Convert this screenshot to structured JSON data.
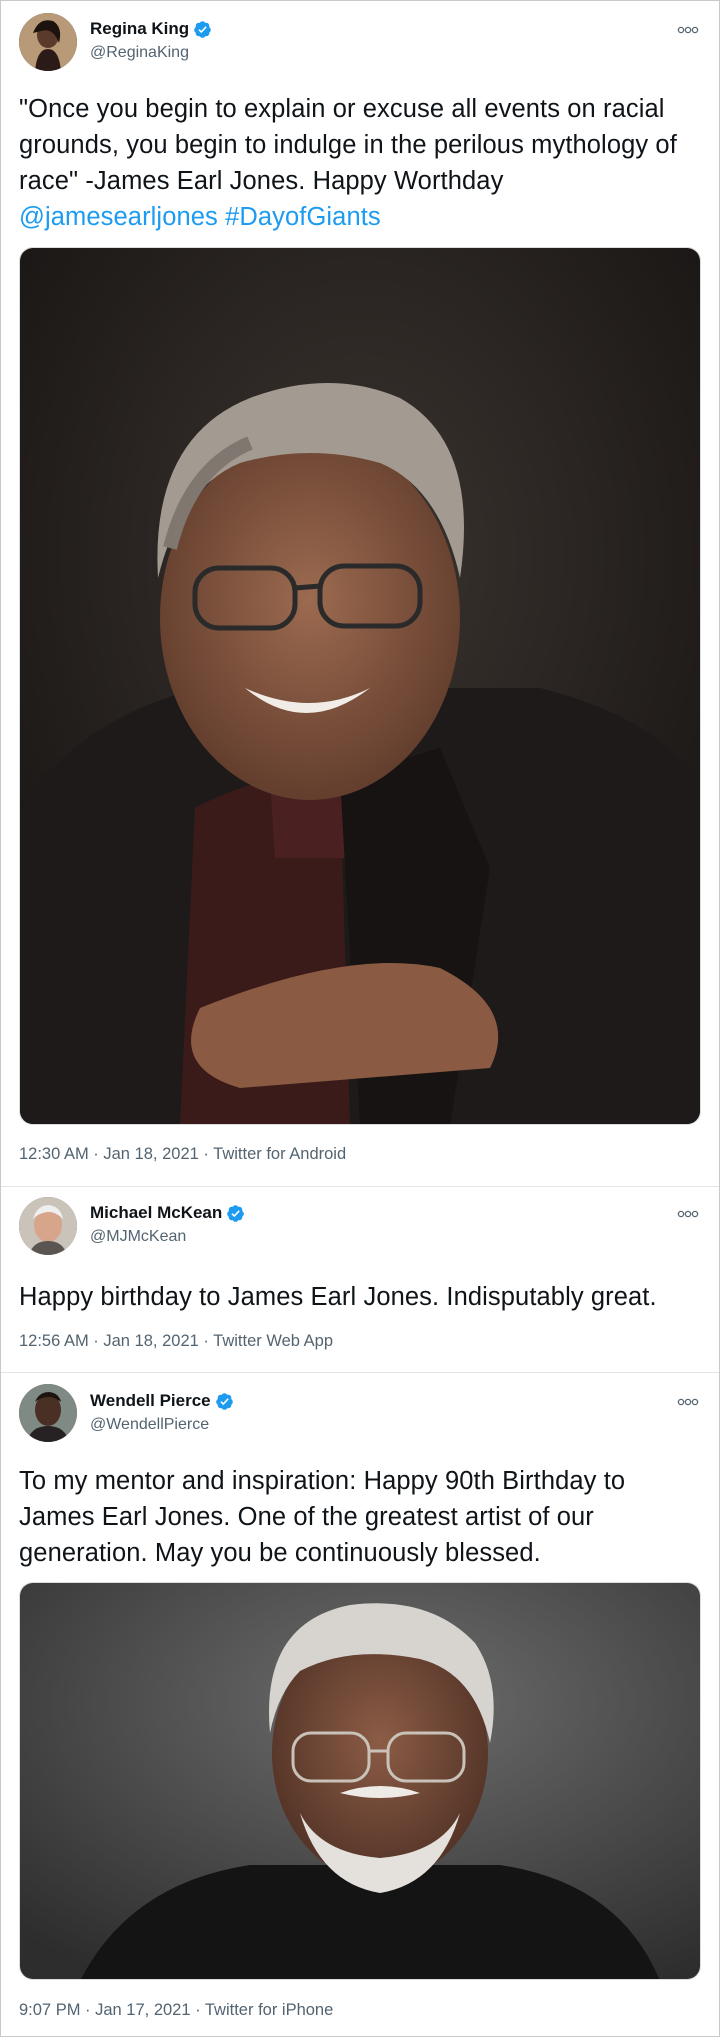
{
  "tweets": [
    {
      "display_name": "Regina King",
      "handle": "@ReginaKing",
      "text_plain": "\"Once you begin to explain or excuse all events on racial grounds, you begin to indulge in the perilous mythology of race\" -James Earl Jones. Happy Worthday ",
      "mention": "@jamesearljones",
      "hashtag": "#DayofGiants",
      "meta": "12:30 AM · Jan 18, 2021 · Twitter for Android",
      "verified": true
    },
    {
      "display_name": "Michael McKean",
      "handle": "@MJMcKean",
      "text_plain": "Happy birthday to James Earl Jones. Indisputably great.",
      "meta": "12:56 AM · Jan 18, 2021 · Twitter Web App",
      "verified": true
    },
    {
      "display_name": "Wendell Pierce",
      "handle": "@WendellPierce",
      "text_plain": "To my mentor and inspiration: Happy 90th Birthday to James Earl Jones. One of the greatest artist of our generation. May you be continuously blessed.",
      "meta": "9:07 PM · Jan 17, 2021 · Twitter for iPhone",
      "verified": true
    }
  ],
  "icons": {
    "verified": "verified-badge-icon",
    "more": "more-options-icon"
  },
  "colors": {
    "link": "#1d9bf0",
    "verified": "#1d9bf0",
    "secondary_text": "#536471",
    "primary_text": "#0f1419"
  }
}
